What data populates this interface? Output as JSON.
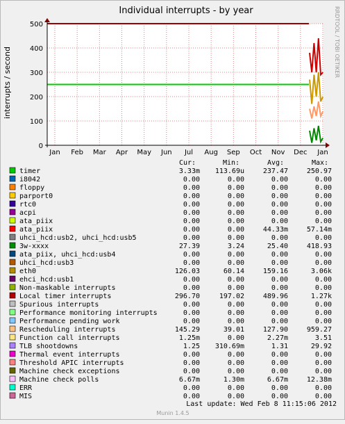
{
  "title": "Individual interrupts - by year",
  "side_text": "RRDTOOL / TOBI OETIKER",
  "footer": "Munin 1.4.5",
  "chart_data": {
    "type": "line",
    "title": "Individual interrupts - by year",
    "ylabel": "interrupts / second",
    "xlabel": "",
    "ylim": [
      0,
      500
    ],
    "yticks": [
      "0",
      "100",
      "200",
      "300",
      "400",
      "500"
    ],
    "xticks": [
      "Jan",
      "Feb",
      "Mar",
      "Apr",
      "May",
      "Jun",
      "Jul",
      "Aug",
      "Sep",
      "Oct",
      "Nov",
      "Dec",
      "Jan"
    ],
    "grid": true,
    "hrules": [
      {
        "value": 500,
        "color": "#a00000"
      },
      {
        "value": 250,
        "color": "#00cc00"
      }
    ],
    "series_recent": [
      {
        "name": "Local timer interrupts",
        "color": "#cc0000",
        "values": [
          380,
          300,
          420,
          300,
          440,
          290,
          300
        ]
      },
      {
        "name": "Rescheduling interrupts",
        "color": "#ff9966",
        "values": [
          150,
          110,
          160,
          120,
          180,
          120,
          140
        ]
      },
      {
        "name": "eth0",
        "color": "#cc9900",
        "values": [
          270,
          170,
          290,
          200,
          300,
          180,
          200
        ]
      },
      {
        "name": "3w-xxxx",
        "color": "#008800",
        "values": [
          60,
          10,
          70,
          20,
          80,
          15,
          30
        ]
      }
    ]
  },
  "legend": {
    "headers": [
      "Cur:",
      "Min:",
      "Avg:",
      "Max:"
    ],
    "rows": [
      {
        "name": "timer",
        "color": "#00cc00",
        "cur": "3.33m",
        "min": "113.69u",
        "avg": "237.47",
        "max": "250.97"
      },
      {
        "name": "i8042",
        "color": "#0066b3",
        "cur": "0.00",
        "min": "0.00",
        "avg": "0.00",
        "max": "0.00"
      },
      {
        "name": "floppy",
        "color": "#ff8000",
        "cur": "0.00",
        "min": "0.00",
        "avg": "0.00",
        "max": "0.00"
      },
      {
        "name": "parport0",
        "color": "#ffcc00",
        "cur": "0.00",
        "min": "0.00",
        "avg": "0.00",
        "max": "0.00"
      },
      {
        "name": "rtc0",
        "color": "#330099",
        "cur": "0.00",
        "min": "0.00",
        "avg": "0.00",
        "max": "0.00"
      },
      {
        "name": "acpi",
        "color": "#990099",
        "cur": "0.00",
        "min": "0.00",
        "avg": "0.00",
        "max": "0.00"
      },
      {
        "name": "ata_piix",
        "color": "#ccff00",
        "cur": "0.00",
        "min": "0.00",
        "avg": "0.00",
        "max": "0.00"
      },
      {
        "name": "ata_piix",
        "color": "#ff0000",
        "cur": "0.00",
        "min": "0.00",
        "avg": "44.33m",
        "max": "57.14m"
      },
      {
        "name": "uhci_hcd:usb2, uhci_hcd:usb5",
        "color": "#808080",
        "cur": "0.00",
        "min": "0.00",
        "avg": "0.00",
        "max": "0.00"
      },
      {
        "name": "3w-xxxx",
        "color": "#008f00",
        "cur": "27.39",
        "min": "3.24",
        "avg": "25.40",
        "max": "418.93"
      },
      {
        "name": "ata_piix, uhci_hcd:usb4",
        "color": "#00487d",
        "cur": "0.00",
        "min": "0.00",
        "avg": "0.00",
        "max": "0.00"
      },
      {
        "name": "uhci_hcd:usb3",
        "color": "#b35a00",
        "cur": "0.00",
        "min": "0.00",
        "avg": "0.00",
        "max": "0.00"
      },
      {
        "name": "eth0",
        "color": "#b38f00",
        "cur": "126.03",
        "min": "60.14",
        "avg": "159.16",
        "max": "3.06k"
      },
      {
        "name": "ehci_hcd:usb1",
        "color": "#6b006b",
        "cur": "0.00",
        "min": "0.00",
        "avg": "0.00",
        "max": "0.00"
      },
      {
        "name": "Non-maskable interrupts",
        "color": "#8fb300",
        "cur": "0.00",
        "min": "0.00",
        "avg": "0.00",
        "max": "0.00"
      },
      {
        "name": "Local timer interrupts",
        "color": "#b30000",
        "cur": "296.70",
        "min": "197.02",
        "avg": "489.96",
        "max": "1.27k"
      },
      {
        "name": "Spurious interrupts",
        "color": "#bebebe",
        "cur": "0.00",
        "min": "0.00",
        "avg": "0.00",
        "max": "0.00"
      },
      {
        "name": "Performance monitoring interrupts",
        "color": "#80ff80",
        "cur": "0.00",
        "min": "0.00",
        "avg": "0.00",
        "max": "0.00"
      },
      {
        "name": "Performance pending work",
        "color": "#80c9ff",
        "cur": "0.00",
        "min": "0.00",
        "avg": "0.00",
        "max": "0.00"
      },
      {
        "name": "Rescheduling interrupts",
        "color": "#ffc080",
        "cur": "145.29",
        "min": "39.01",
        "avg": "127.90",
        "max": "959.27"
      },
      {
        "name": "Function call interrupts",
        "color": "#ffe680",
        "cur": "1.25m",
        "min": "0.00",
        "avg": "2.27m",
        "max": "3.51"
      },
      {
        "name": "TLB shootdowns",
        "color": "#aa80ff",
        "cur": "1.25",
        "min": "310.69m",
        "avg": "1.31",
        "max": "29.92"
      },
      {
        "name": "Thermal event interrupts",
        "color": "#ee00cc",
        "cur": "0.00",
        "min": "0.00",
        "avg": "0.00",
        "max": "0.00"
      },
      {
        "name": "Threshold APIC interrupts",
        "color": "#ff8080",
        "cur": "0.00",
        "min": "0.00",
        "avg": "0.00",
        "max": "0.00"
      },
      {
        "name": "Machine check exceptions",
        "color": "#666600",
        "cur": "0.00",
        "min": "0.00",
        "avg": "0.00",
        "max": "0.00"
      },
      {
        "name": "Machine check polls",
        "color": "#ffbfff",
        "cur": "6.67m",
        "min": "1.30m",
        "avg": "6.67m",
        "max": "12.38m"
      },
      {
        "name": "ERR",
        "color": "#00ffcc",
        "cur": "0.00",
        "min": "0.00",
        "avg": "0.00",
        "max": "0.00"
      },
      {
        "name": "MIS",
        "color": "#cc6699",
        "cur": "0.00",
        "min": "0.00",
        "avg": "0.00",
        "max": "0.00"
      }
    ],
    "last_update": "Last update:  Wed Feb  8 11:15:06 2012"
  }
}
